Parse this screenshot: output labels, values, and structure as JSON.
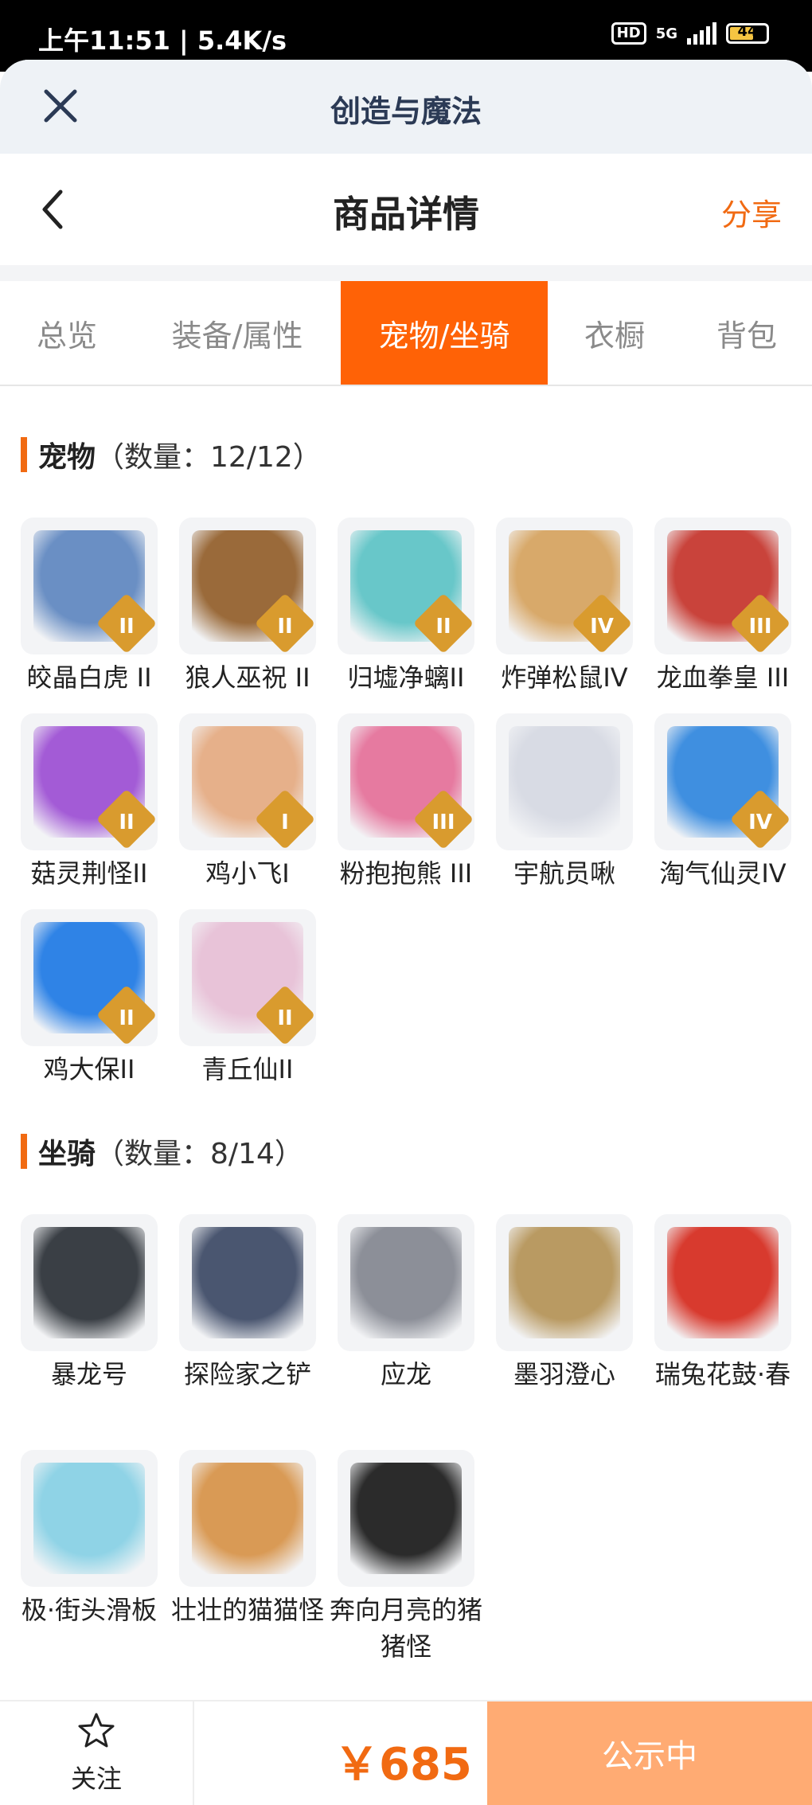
{
  "status_bar": {
    "time": "上午11:51 | 5.4K/s",
    "network": "5G",
    "hd": "HD",
    "battery": "44"
  },
  "app_bar": {
    "title": "创造与魔法"
  },
  "nav": {
    "title": "商品详情",
    "share": "分享"
  },
  "tabs": [
    {
      "label": "总览"
    },
    {
      "label": "装备/属性"
    },
    {
      "label": "宠物/坐骑",
      "active": true
    },
    {
      "label": "衣橱"
    },
    {
      "label": "背包"
    }
  ],
  "pets": {
    "title": "宠物",
    "count": "（数量：12/12）",
    "items": [
      {
        "name": "皎晶白虎 II",
        "badge": "II",
        "color": "#6a8fc4"
      },
      {
        "name": "狼人巫祝 II",
        "badge": "II",
        "color": "#9a6a3a"
      },
      {
        "name": "归墟净螭II",
        "badge": "II",
        "color": "#68c7c9"
      },
      {
        "name": "炸弹松鼠IV",
        "badge": "IV",
        "color": "#d8a96a"
      },
      {
        "name": "龙血拳皇 III",
        "badge": "III",
        "color": "#c9433b"
      },
      {
        "name": "菇灵荆怪II",
        "badge": "II",
        "color": "#a35bd6"
      },
      {
        "name": "鸡小飞I",
        "badge": "I",
        "color": "#e6b08a"
      },
      {
        "name": "粉抱抱熊 III",
        "badge": "III",
        "color": "#e67aa0"
      },
      {
        "name": "宇航员啾",
        "badge": "",
        "color": "#d8dbe4"
      },
      {
        "name": "淘气仙灵IV",
        "badge": "IV",
        "color": "#3f8fe0"
      },
      {
        "name": "鸡大保II",
        "badge": "II",
        "color": "#2f83e6"
      },
      {
        "name": "青丘仙II",
        "badge": "II",
        "color": "#e8c3d8"
      }
    ]
  },
  "mounts": {
    "title": "坐骑",
    "count": "（数量：8/14）",
    "items": [
      {
        "name": "暴龙号",
        "color": "#3a3f45"
      },
      {
        "name": "探险家之铲",
        "color": "#4a5670"
      },
      {
        "name": "应龙",
        "color": "#8c8f98"
      },
      {
        "name": "墨羽澄心",
        "color": "#b99a62"
      },
      {
        "name": "瑞兔花鼓·春",
        "color": "#d83a2e"
      },
      {
        "name": "极·街头滑板",
        "color": "#8fd3e6"
      },
      {
        "name": "壮壮的猫猫怪",
        "color": "#d99a55"
      },
      {
        "name": "奔向月亮的猪猪怪",
        "color": "#2b2b2b"
      }
    ]
  },
  "bottom": {
    "follow": "关注",
    "price": "￥685",
    "status_button": "公示中"
  },
  "colors": {
    "accent": "#ff6206",
    "price": "#f16a12",
    "button": "#ffab73"
  }
}
